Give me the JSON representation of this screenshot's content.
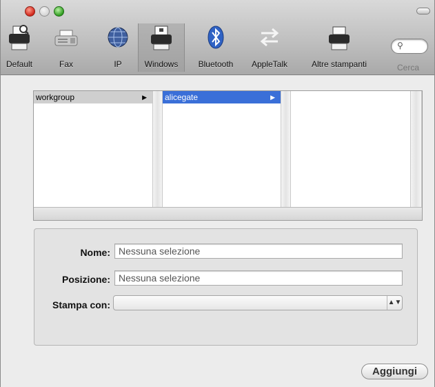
{
  "toolbar": {
    "items": [
      {
        "label": "Default",
        "icon": "printer-icon"
      },
      {
        "label": "Fax",
        "icon": "fax-icon"
      },
      {
        "label": "IP",
        "icon": "globe-icon"
      },
      {
        "label": "Windows",
        "icon": "windows-printer-icon",
        "selected": true
      },
      {
        "label": "Bluetooth",
        "icon": "bluetooth-icon"
      },
      {
        "label": "AppleTalk",
        "icon": "appletalk-arrows-icon"
      },
      {
        "label": "Altre stampanti",
        "icon": "printer-icon"
      }
    ],
    "search_label": "Cerca"
  },
  "browser": {
    "col1": [
      {
        "label": "workgroup",
        "selected": "inactive"
      }
    ],
    "col2": [
      {
        "label": "alicegate",
        "selected": "active"
      }
    ],
    "col3": []
  },
  "form": {
    "name_label": "Nome:",
    "name_value": "Nessuna selezione",
    "location_label": "Posizione:",
    "location_value": "Nessuna selezione",
    "print_with_label": "Stampa con:",
    "print_with_value": ""
  },
  "add_button": "Aggiungi",
  "colors": {
    "selection_active": "#3a6fd8",
    "selection_inactive": "#cfcfcf",
    "close": "#d0261a",
    "zoom": "#2f9c1f"
  }
}
